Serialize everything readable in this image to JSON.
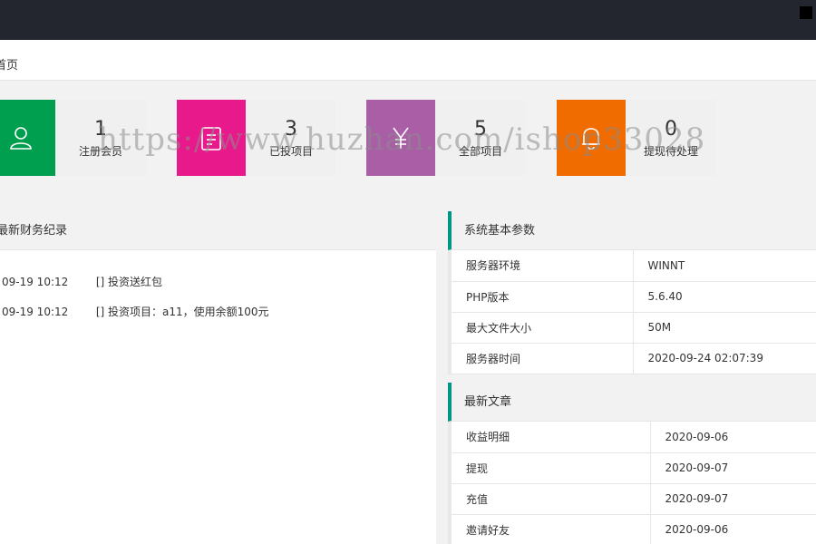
{
  "tabs": {
    "home": "首页"
  },
  "stats": [
    {
      "value": "1",
      "label": "注册会员",
      "color": "#009f50",
      "icon": "user-icon"
    },
    {
      "value": "3",
      "label": "已投项目",
      "color": "#e8198b",
      "icon": "clipboard-icon"
    },
    {
      "value": "5",
      "label": "全部项目",
      "color": "#a95ea6",
      "icon": "yen-icon"
    },
    {
      "value": "0",
      "label": "提现待处理",
      "color": "#f06b00",
      "icon": "bell-icon"
    }
  ],
  "finance": {
    "title": "最新财务纪录",
    "rows": [
      {
        "date": "09-19 10:12",
        "desc": "[] 投资送红包"
      },
      {
        "date": "09-19 10:12",
        "desc": "[] 投资项目：a11，使用余额100元"
      }
    ]
  },
  "system": {
    "title": "系统基本参数",
    "rows": [
      {
        "key": "服务器环境",
        "value": "WINNT"
      },
      {
        "key": "PHP版本",
        "value": "5.6.40"
      },
      {
        "key": "最大文件大小",
        "value": "50M"
      },
      {
        "key": "服务器时间",
        "value": "2020-09-24 02:07:39"
      }
    ]
  },
  "articles": {
    "title": "最新文章",
    "rows": [
      {
        "key": "收益明细",
        "value": "2020-09-06"
      },
      {
        "key": "提现",
        "value": "2020-09-07"
      },
      {
        "key": "充值",
        "value": "2020-09-07"
      },
      {
        "key": "邀请好友",
        "value": "2020-09-06"
      }
    ]
  },
  "watermark": "https://www.huzhan.com/ishop33028"
}
